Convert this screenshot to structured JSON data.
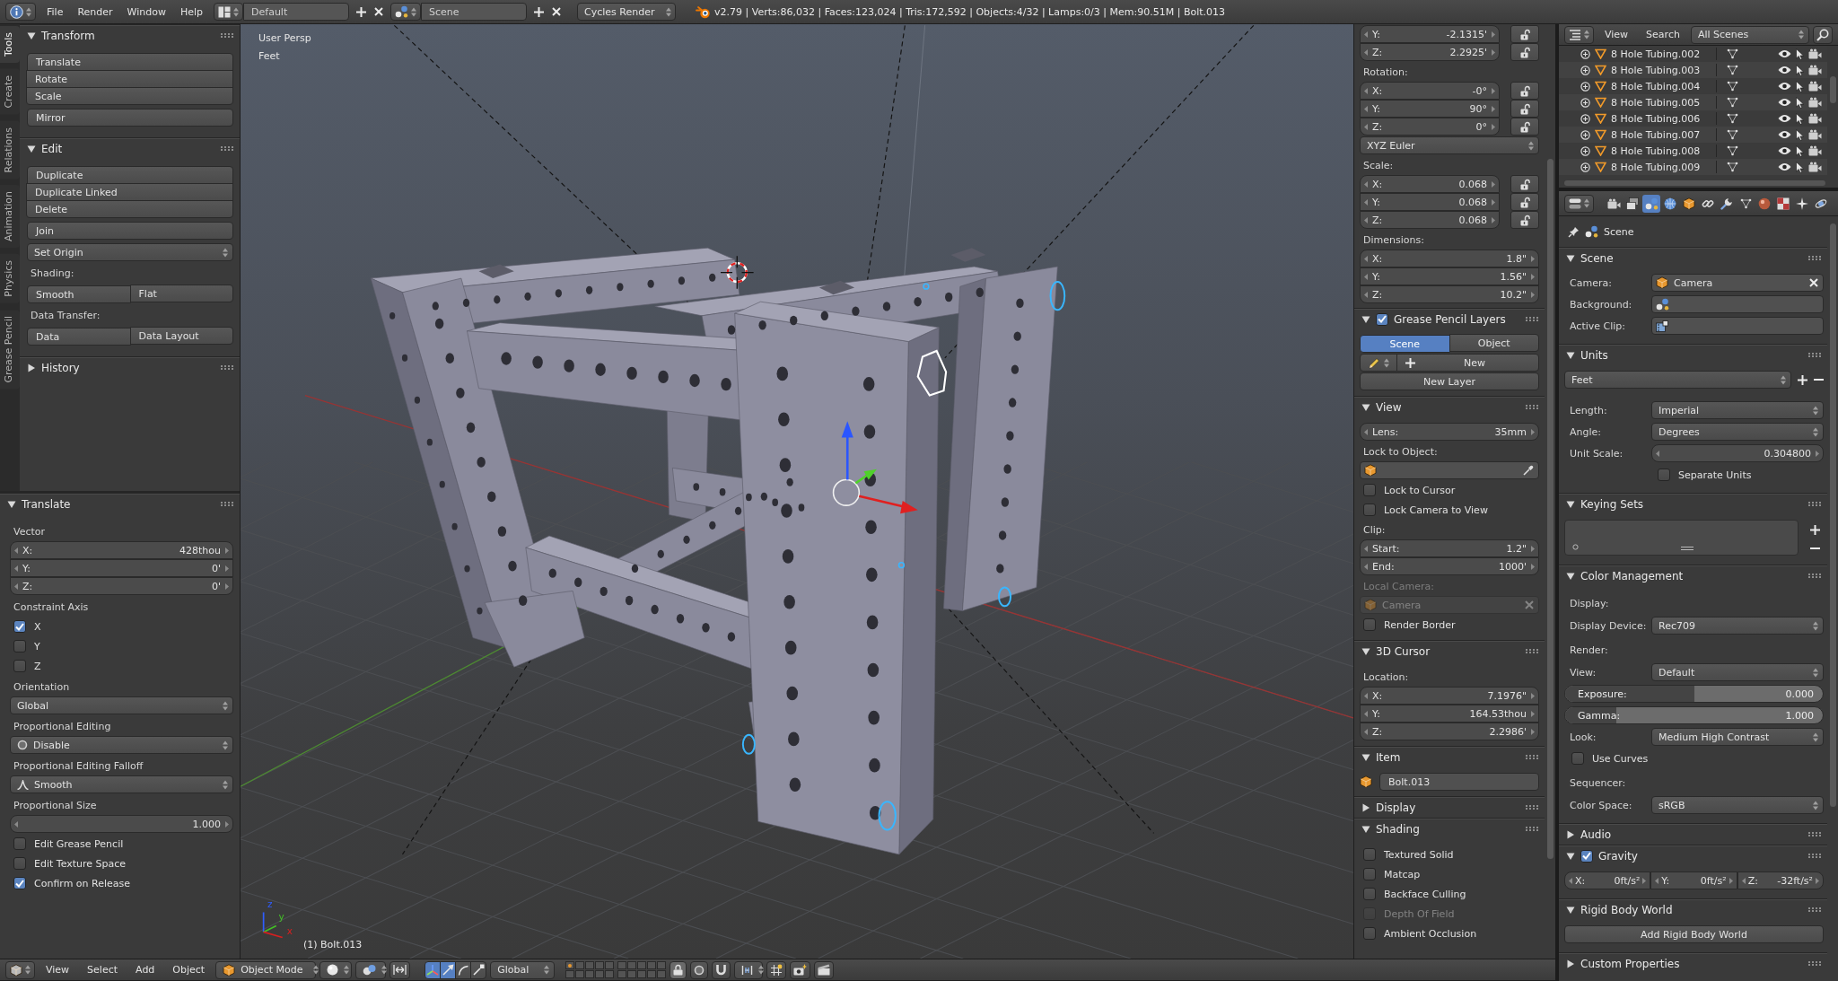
{
  "top_bar": {
    "menus": [
      "File",
      "Render",
      "Window",
      "Help"
    ],
    "layout": "Default",
    "scene": "Scene",
    "engine": "Cycles Render",
    "stats": "v2.79 | Verts:86,032 | Faces:123,024 | Tris:172,592 | Objects:4/32 | Lamps:0/3 | Mem:90.51M | Bolt.013"
  },
  "tool_shelf": {
    "tabs": [
      {
        "label": "Tools",
        "selected": true
      },
      {
        "label": "Create",
        "selected": false
      },
      {
        "label": "Relations",
        "selected": false
      },
      {
        "label": "Animation",
        "selected": false
      },
      {
        "label": "Physics",
        "selected": false
      },
      {
        "label": "Grease Pencil",
        "selected": false
      }
    ],
    "panels": [
      {
        "title": "Transform",
        "expanded": true,
        "items": [
          {
            "kind": "stack",
            "labels": [
              "Translate",
              "Rotate",
              "Scale"
            ]
          },
          {
            "kind": "stack",
            "labels": [
              "Mirror"
            ]
          }
        ]
      },
      {
        "title": "Edit",
        "expanded": true,
        "items": [
          {
            "kind": "stack",
            "labels": [
              "Duplicate",
              "Duplicate Linked",
              "Delete"
            ]
          },
          {
            "kind": "stack",
            "labels": [
              "Join"
            ]
          },
          {
            "kind": "dropdown",
            "value": "Set Origin"
          },
          {
            "kind": "label",
            "text": "Shading:"
          },
          {
            "kind": "row",
            "labels": [
              "Smooth",
              "Flat"
            ]
          },
          {
            "kind": "label",
            "text": "Data Transfer:"
          },
          {
            "kind": "row",
            "labels": [
              "Data",
              "Data Layout"
            ]
          }
        ]
      },
      {
        "title": "History",
        "expanded": false
      }
    ]
  },
  "redo_panel": {
    "title": "Translate",
    "expanded": true,
    "items": [
      {
        "kind": "label",
        "text": "Vector"
      },
      {
        "kind": "vector",
        "fields": [
          {
            "label": "X:",
            "value": "428thou"
          },
          {
            "label": "Y:",
            "value": "0'"
          },
          {
            "label": "Z:",
            "value": "0'"
          }
        ]
      },
      {
        "kind": "label",
        "text": "Constraint Axis"
      },
      {
        "kind": "checkbox",
        "label": "X",
        "checked": true
      },
      {
        "kind": "checkbox",
        "label": "Y",
        "checked": false
      },
      {
        "kind": "checkbox",
        "label": "Z",
        "checked": false
      },
      {
        "kind": "label",
        "text": "Orientation"
      },
      {
        "kind": "dropdown",
        "value": "Global"
      },
      {
        "kind": "label",
        "text": "Proportional Editing"
      },
      {
        "kind": "proportional",
        "value": "Disable"
      },
      {
        "kind": "label",
        "text": "Proportional Editing Falloff"
      },
      {
        "kind": "falloff",
        "value": "Smooth"
      },
      {
        "kind": "label",
        "text": "Proportional Size"
      },
      {
        "kind": "vector",
        "fields": [
          {
            "value": "1.000"
          }
        ]
      },
      {
        "kind": "checkbox",
        "label": "Edit Grease Pencil",
        "checked": false
      },
      {
        "kind": "checkbox",
        "label": "Edit Texture Space",
        "checked": false
      },
      {
        "kind": "checkbox",
        "label": "Confirm on Release",
        "checked": true
      }
    ]
  },
  "viewport": {
    "view_name": "User Persp",
    "units": "Feet",
    "axis_labels": [
      "z",
      "y",
      "x"
    ],
    "active_object": "(1) Bolt.013"
  },
  "sidebar": {
    "items": [
      {
        "kind": "lockvector",
        "fields": [
          {
            "label": "Y:",
            "value": "-2.1315'"
          },
          {
            "label": "Z:",
            "value": "2.2925'"
          }
        ]
      },
      {
        "kind": "label",
        "text": "Rotation:"
      },
      {
        "kind": "lockvector",
        "fields": [
          {
            "label": "X:",
            "value": "-0°"
          },
          {
            "label": "Y:",
            "value": "90°"
          },
          {
            "label": "Z:",
            "value": "0°"
          }
        ]
      },
      {
        "kind": "dropdown",
        "value": "XYZ Euler"
      },
      {
        "kind": "label",
        "text": "Scale:"
      },
      {
        "kind": "lockvector",
        "fields": [
          {
            "label": "X:",
            "value": "0.068"
          },
          {
            "label": "Y:",
            "value": "0.068"
          },
          {
            "label": "Z:",
            "value": "0.068"
          }
        ]
      },
      {
        "kind": "label",
        "text": "Dimensions:"
      },
      {
        "kind": "vector",
        "fields": [
          {
            "label": "X:",
            "value": "1.8\""
          },
          {
            "label": "Y:",
            "value": "1.56\""
          },
          {
            "label": "Z:",
            "value": "10.2\""
          }
        ]
      }
    ],
    "panels": [
      {
        "title": "Grease Pencil Layers",
        "expanded": true,
        "header_checkbox": {
          "checked": true
        },
        "items": [
          {
            "kind": "segment",
            "options": [
              {
                "label": "Scene",
                "selected": true
              },
              {
                "label": "Object",
                "selected": false
              }
            ]
          },
          {
            "kind": "datanew",
            "label": "New"
          },
          {
            "kind": "button",
            "label": "New Layer"
          }
        ]
      },
      {
        "title": "View",
        "expanded": true,
        "items": [
          {
            "kind": "vector",
            "fields": [
              {
                "label": "Lens:",
                "value": "35mm"
              }
            ],
            "disabled": false
          },
          {
            "kind": "label",
            "text": "Lock to Object:",
            "disabled": false
          },
          {
            "kind": "picker",
            "disabled": false
          },
          {
            "kind": "checkbox",
            "label": "Lock to Cursor",
            "checked": false,
            "disabled": false
          },
          {
            "kind": "checkbox",
            "label": "Lock Camera to View",
            "checked": false,
            "disabled": false
          },
          {
            "kind": "label",
            "text": "Clip:",
            "disabled": false
          },
          {
            "kind": "vector",
            "fields": [
              {
                "label": "Start:",
                "value": "1.2\""
              },
              {
                "label": "End:",
                "value": "1000'"
              }
            ],
            "disabled": false
          },
          {
            "kind": "label",
            "text": "Local Camera:",
            "disabled": true
          },
          {
            "kind": "object",
            "value": "Camera",
            "disabled": true
          },
          {
            "kind": "checkbox",
            "label": "Render Border",
            "checked": false,
            "disabled": false
          }
        ]
      },
      {
        "title": "3D Cursor",
        "expanded": true,
        "items": [
          {
            "kind": "label",
            "text": "Location:"
          },
          {
            "kind": "vector",
            "fields": [
              {
                "label": "X:",
                "value": "7.1976\""
              },
              {
                "label": "Y:",
                "value": "164.53thou"
              },
              {
                "label": "Z:",
                "value": "2.2986'"
              }
            ]
          }
        ]
      },
      {
        "title": "Item",
        "expanded": true,
        "items": [
          {
            "kind": "namefield",
            "value": "Bolt.013"
          }
        ]
      },
      {
        "title": "Display",
        "expanded": false
      },
      {
        "title": "Shading",
        "expanded": true,
        "items": [
          {
            "kind": "checkbox",
            "label": "Textured Solid",
            "checked": false,
            "disabled": false
          },
          {
            "kind": "checkbox",
            "label": "Matcap",
            "checked": false,
            "disabled": false
          },
          {
            "kind": "checkbox",
            "label": "Backface Culling",
            "checked": false,
            "disabled": false
          },
          {
            "kind": "checkbox",
            "label": "Depth Of Field",
            "checked": false,
            "disabled": true
          },
          {
            "kind": "checkbox",
            "label": "Ambient Occlusion",
            "checked": false,
            "disabled": false
          }
        ]
      }
    ]
  },
  "outliner": {
    "menus": [
      "View",
      "Search"
    ],
    "filter": "All Scenes",
    "rows": [
      "8 Hole Tubing.002",
      "8 Hole Tubing.003",
      "8 Hole Tubing.004",
      "8 Hole Tubing.005",
      "8 Hole Tubing.006",
      "8 Hole Tubing.007",
      "8 Hole Tubing.008",
      "8 Hole Tubing.009"
    ]
  },
  "properties": {
    "tabs": [
      {
        "selected": false
      },
      {
        "selected": false
      },
      {
        "selected": true
      },
      {
        "selected": false
      },
      {
        "selected": false
      },
      {
        "selected": false
      },
      {
        "selected": false
      },
      {
        "selected": false
      },
      {
        "selected": false
      },
      {
        "selected": false
      },
      {
        "selected": false
      },
      {
        "selected": false
      }
    ],
    "breadcrumb": "Scene",
    "panels": [
      {
        "title": "Scene",
        "expanded": true,
        "items": [
          {
            "kind": "object",
            "label": "Camera:",
            "value": "Camera"
          },
          {
            "kind": "scenefield",
            "label": "Background:"
          },
          {
            "kind": "clipfield",
            "label": "Active Clip:"
          }
        ]
      },
      {
        "title": "Units",
        "expanded": true,
        "items": [
          {
            "kind": "preset",
            "value": "Feet"
          },
          {
            "kind": "dropdown",
            "label": "Length:",
            "value": "Imperial"
          },
          {
            "kind": "dropdown",
            "label": "Angle:",
            "value": "Degrees"
          },
          {
            "kind": "vector",
            "label": "Unit Scale:",
            "fields": [
              {
                "value": "0.304800"
              }
            ]
          },
          {
            "kind": "subcheckbox",
            "label": "Separate Units",
            "checked": false
          }
        ]
      },
      {
        "title": "Keying Sets",
        "expanded": true,
        "items": [
          {
            "kind": "uilist"
          }
        ]
      },
      {
        "title": "Color Management",
        "expanded": true,
        "items": [
          {
            "kind": "label",
            "text": "Display:"
          },
          {
            "kind": "dropdown",
            "label": "Display Device:",
            "value": "Rec709"
          },
          {
            "kind": "label",
            "text": "Render:"
          },
          {
            "kind": "dropdown",
            "label": "View:",
            "value": "Default"
          },
          {
            "kind": "slider",
            "label": "Exposure:",
            "value": "0.000",
            "level": 0.5
          },
          {
            "kind": "slider",
            "label": "Gamma:",
            "value": "1.000",
            "level": 0.2
          },
          {
            "kind": "dropdown",
            "label": "Look:",
            "value": "Medium High Contrast"
          },
          {
            "kind": "checkbox",
            "label": "Use Curves",
            "checked": false
          },
          {
            "kind": "label",
            "text": "Sequencer:"
          },
          {
            "kind": "dropdown",
            "label": "Color Space:",
            "value": "sRGB"
          }
        ]
      },
      {
        "title": "Audio",
        "expanded": false
      },
      {
        "title": "Gravity",
        "expanded": true,
        "header_checkbox": {
          "checked": true
        },
        "items": [
          {
            "kind": "hnumbers",
            "fields": [
              {
                "label": "X:",
                "value": "0ft/s²"
              },
              {
                "label": "Y:",
                "value": "0ft/s²"
              },
              {
                "label": "Z:",
                "value": "-32ft/s²"
              }
            ]
          }
        ]
      },
      {
        "title": "Rigid Body World",
        "expanded": true,
        "items": [
          {
            "kind": "button",
            "label": "Add Rigid Body World"
          }
        ]
      },
      {
        "title": "Custom Properties",
        "expanded": false
      }
    ]
  },
  "view3d_header": {
    "menus": [
      "View",
      "Select",
      "Add",
      "Object"
    ],
    "mode": "Object Mode",
    "manipulator_on": true,
    "manipulators": [
      {
        "selected": true
      },
      {
        "selected": false
      },
      {
        "selected": false
      }
    ],
    "orientation": "Global"
  }
}
